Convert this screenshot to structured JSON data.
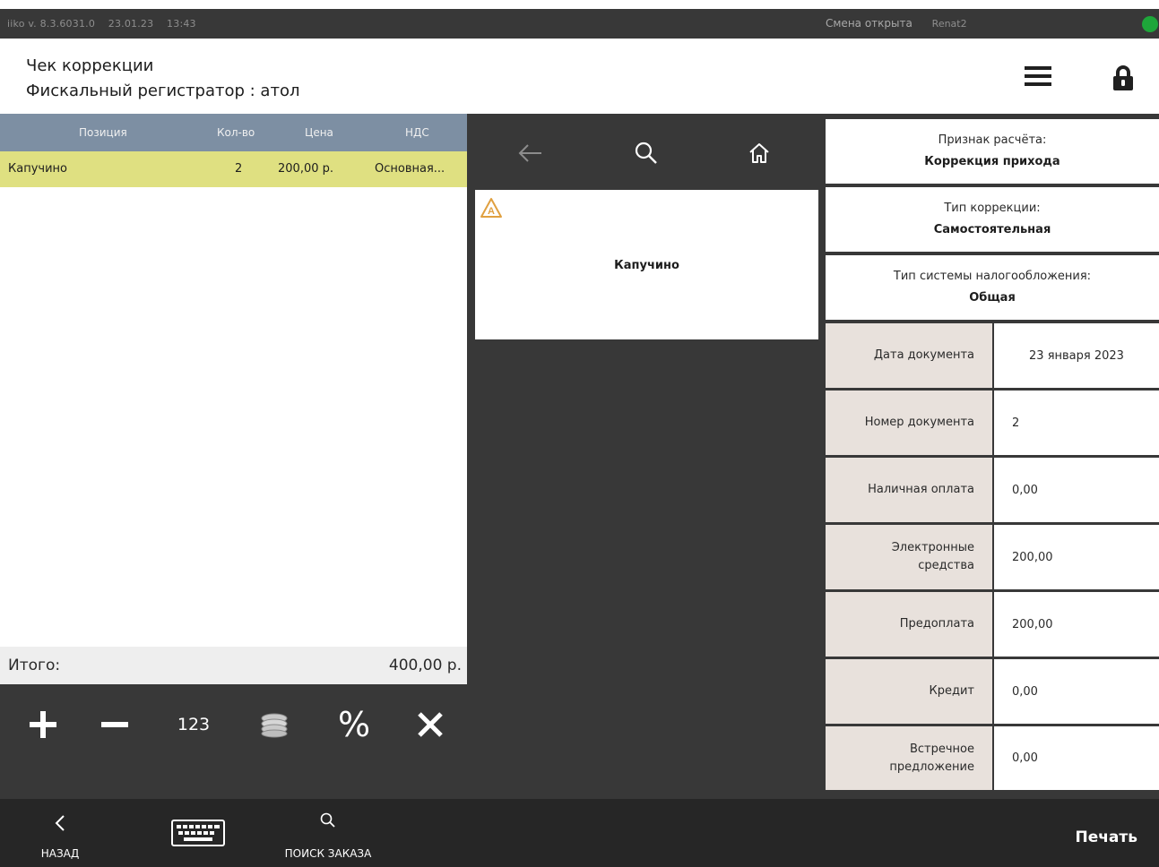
{
  "status_bar": {
    "version": "iiko v. 8.3.6031.0",
    "date": "23.01.23",
    "time": "13:43",
    "shift_status": "Смена открыта",
    "user": "Renat2",
    "online_color": "#1ea63a"
  },
  "header": {
    "title": "Чек коррекции",
    "subtitle": "Фискальный регистратор :  атол",
    "menu_icon": "hamburger-icon",
    "lock_icon": "lock-icon"
  },
  "order_table": {
    "columns": [
      "Позиция",
      "Кол-во",
      "Цена",
      "НДС"
    ],
    "rows": [
      {
        "position": "Капучино",
        "qty": "2",
        "price": "200,00 р.",
        "vat": "Основная..."
      }
    ],
    "header_color": "#7d8fa3",
    "selected_row_color": "#dfe081"
  },
  "total": {
    "label": "Итого:",
    "value": "400,00 р."
  },
  "tools": {
    "add": "+",
    "remove": "−",
    "numeric": "123",
    "coins_icon": "coins-icon",
    "discount": "%",
    "delete_icon": "close-icon"
  },
  "product_nav": {
    "back_icon": "arrow-left-icon",
    "search_icon": "search-icon",
    "home_icon": "home-icon"
  },
  "product_tile": {
    "label": "Капучино",
    "warning_icon": "warning-a-icon"
  },
  "fiscal": {
    "calc_sign_label": "Признак расчёта:",
    "calc_sign_value": "Коррекция прихода",
    "correction_type_label": "Тип коррекции:",
    "correction_type_value": "Самостоятельная",
    "tax_system_label": "Тип системы налогообложения:",
    "tax_system_value": "Общая",
    "fields": [
      {
        "label": "Дата документа",
        "value": "23 января 2023"
      },
      {
        "label": "Номер документа",
        "value": "2"
      },
      {
        "label": "Наличная оплата",
        "value": "0,00"
      },
      {
        "label": "Электронные\nсредства",
        "value": "200,00"
      },
      {
        "label": "Предоплата",
        "value": "200,00"
      },
      {
        "label": "Кредит",
        "value": "0,00"
      },
      {
        "label": "Встречное\nпредложение",
        "value": "0,00"
      }
    ]
  },
  "bottom_bar": {
    "back_label": "НАЗАД",
    "keyboard_icon": "keyboard-icon",
    "search_order_label": "ПОИСК ЗАКАЗА",
    "print_label": "Печать"
  }
}
